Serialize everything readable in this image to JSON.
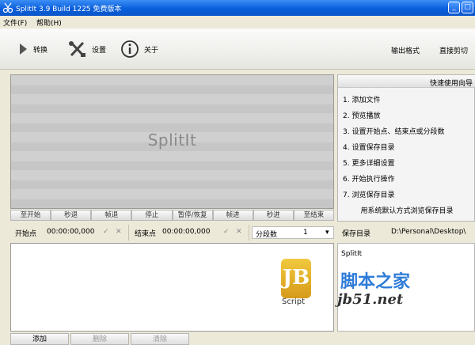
{
  "window": {
    "title": "SplitIt 3.9 Build 1225 免费版本",
    "icons": {
      "app": "scissors-app-icon",
      "minimize": "minimize-icon",
      "maximize": "maximize-icon"
    }
  },
  "menu": {
    "file": "文件(F)",
    "help": "帮助(H)"
  },
  "toolbar": {
    "convert": "转换",
    "settings": "设置",
    "about": "关于",
    "output_format": "输出格式",
    "direct_cut": "直接剪切"
  },
  "preview": {
    "logo": "SplitIt"
  },
  "playback": [
    "至开始",
    "秒退",
    "帧退",
    "停止",
    "暂停/恢复",
    "帧进",
    "秒进",
    "至结束"
  ],
  "times": {
    "start_label": "开始点",
    "start_value": "00:00:00,000",
    "end_label": "结束点",
    "end_value": "00:00:00,000",
    "segments_label": "分段数",
    "segments_value": "1"
  },
  "quick_guide": {
    "title": "快速使用向导",
    "steps": [
      "1. 添加文件",
      "2. 预览播放",
      "3. 设置开始点、结束点或分段数",
      "4. 设置保存目录",
      "5. 更多详细设置",
      "6. 开始执行操作",
      "7. 浏览保存目录"
    ],
    "footer": "用系统默认方式浏览保存目录"
  },
  "save": {
    "label": "保存目录",
    "path": "D:\\Personal\\Desktop\\"
  },
  "info": {
    "title": "SplitIt"
  },
  "watermark": {
    "letters": "JB",
    "script": "Script",
    "cn": "脚本之家",
    "url": "jb51.net"
  },
  "bottom": {
    "add": "添加",
    "delete": "删除",
    "clear": "清除"
  },
  "colors": {
    "titlebar": "#0a5fdc",
    "watermark_blue": "#2f7cd8",
    "watermark_gold": "#d69a1a"
  }
}
